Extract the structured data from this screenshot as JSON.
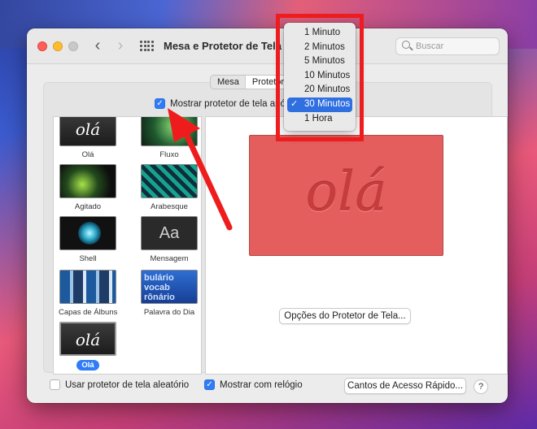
{
  "window": {
    "title": "Mesa e Protetor de Tela",
    "search_placeholder": "Buscar"
  },
  "tabs": [
    {
      "label": "Mesa"
    },
    {
      "label": "Protetor"
    }
  ],
  "options": {
    "start_after_label": "Mostrar protetor de tela após",
    "start_after_checked": true,
    "random_label": "Usar protetor de tela aleatório",
    "random_checked": false,
    "clock_label": "Mostrar com relógio",
    "clock_checked": true
  },
  "savers": [
    {
      "label": "Olá",
      "thumb_text": "olá"
    },
    {
      "label": "Fluxo"
    },
    {
      "label": "Agitado"
    },
    {
      "label": "Arabesque"
    },
    {
      "label": "Shell"
    },
    {
      "label": "Mensagem",
      "thumb_text": "Aa"
    },
    {
      "label": "Capas de Álbuns"
    },
    {
      "label": "Palavra do Dia",
      "thumb_text": "bulário vocab rônário"
    },
    {
      "label": "Olá",
      "thumb_text": "olá",
      "selected": true
    }
  ],
  "preview": {
    "text": "olá"
  },
  "buttons": {
    "options": "Opções do Protetor de Tela...",
    "hot_corners": "Cantos de Acesso Rápido...",
    "help": "?"
  },
  "time_menu": {
    "items": [
      "1 Minuto",
      "2 Minutos",
      "5 Minutos",
      "10 Minutos",
      "20 Minutos",
      "30 Minutos",
      "1 Hora"
    ],
    "selected": "30 Minutos",
    "check": "✓"
  },
  "colors": {
    "accent": "#2f7cf6",
    "annotation": "#ee1c1c",
    "preview_bg": "#e45e5e"
  }
}
